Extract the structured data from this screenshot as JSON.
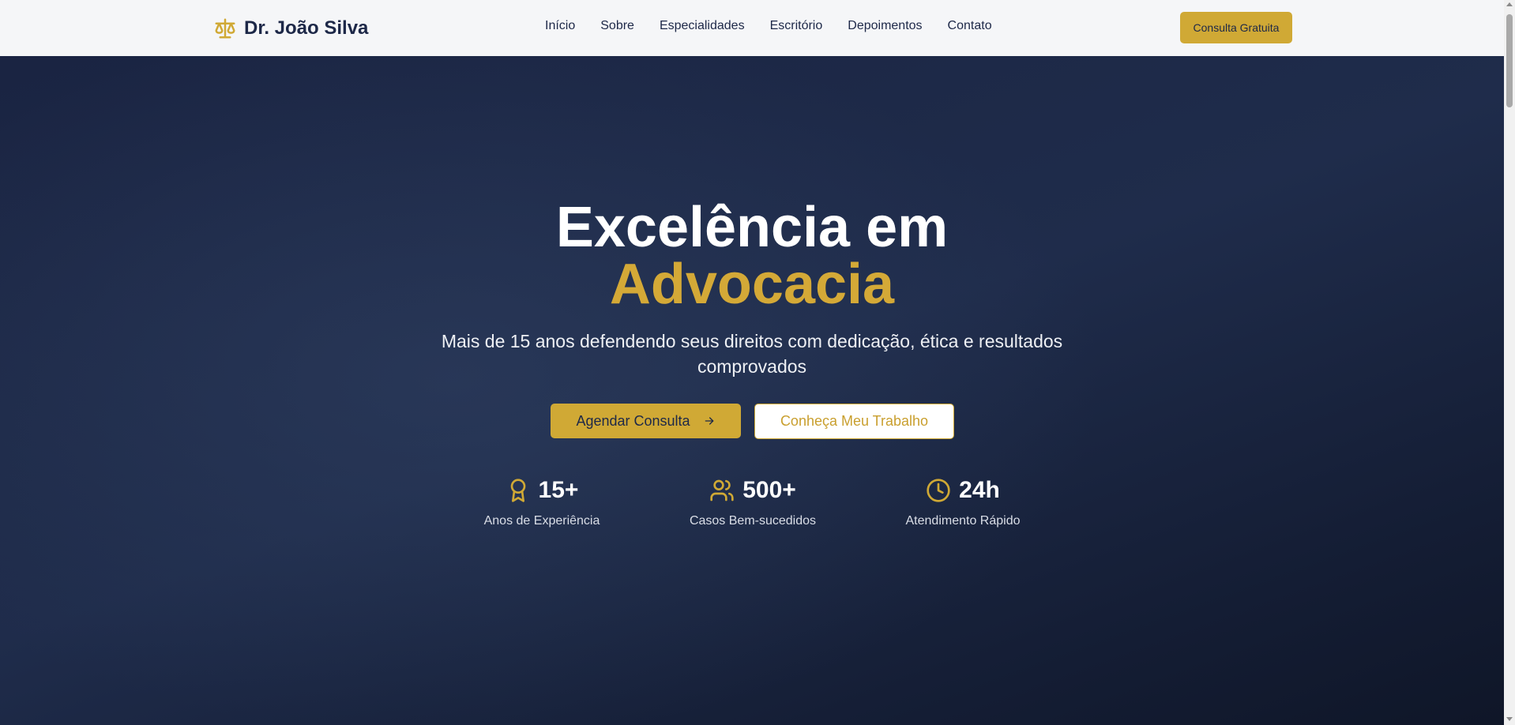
{
  "colors": {
    "navy": "#1d2848",
    "gold": "#d0a935",
    "hero_bg": "#1b2744"
  },
  "brand": {
    "icon": "scale-icon",
    "name": "Dr. João Silva"
  },
  "nav": {
    "links": [
      "Início",
      "Sobre",
      "Especialidades",
      "Escritório",
      "Depoimentos",
      "Contato"
    ],
    "cta": "Consulta Gratuita"
  },
  "hero": {
    "title_line1": "Excelência em",
    "title_line2": "Advocacia",
    "subtitle": "Mais de 15 anos defendendo seus direitos com dedicação, ética e resultados comprovados",
    "primary_button": "Agendar Consulta",
    "primary_button_icon": "arrow-right-icon",
    "secondary_button": "Conheça Meu Trabalho"
  },
  "stats": [
    {
      "icon": "award-icon",
      "value": "15+",
      "label": "Anos de Experiência"
    },
    {
      "icon": "users-icon",
      "value": "500+",
      "label": "Casos Bem-sucedidos"
    },
    {
      "icon": "clock-icon",
      "value": "24h",
      "label": "Atendimento Rápido"
    }
  ]
}
